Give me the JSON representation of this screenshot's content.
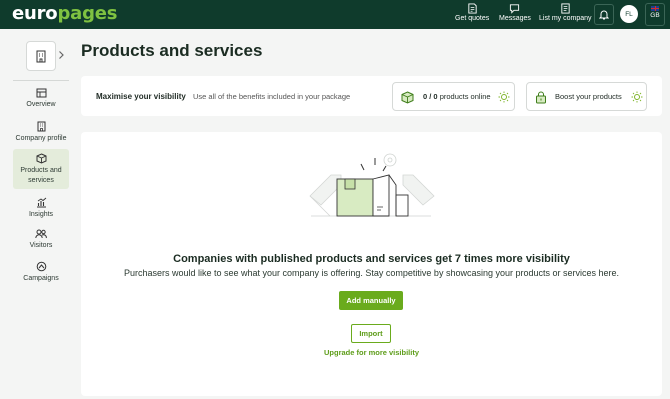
{
  "header": {
    "logo_part1": "euro",
    "logo_part2": "pages",
    "nav": [
      {
        "label": "Get quotes",
        "icon": "quotes-icon"
      },
      {
        "label": "Messages",
        "icon": "messages-icon"
      },
      {
        "label": "List my company",
        "icon": "list-company-icon"
      }
    ],
    "avatar_initials": "FL",
    "language": "GB"
  },
  "sidebar": {
    "items": [
      {
        "label": "Overview",
        "icon": "overview-icon",
        "active": false
      },
      {
        "label": "Company profile",
        "icon": "company-profile-icon",
        "active": false
      },
      {
        "label": "Products and services",
        "icon": "products-icon",
        "active": true
      },
      {
        "label": "Insights",
        "icon": "insights-icon",
        "active": false
      },
      {
        "label": "Visitors",
        "icon": "visitors-icon",
        "active": false
      },
      {
        "label": "Campaigns",
        "icon": "campaigns-icon",
        "active": false
      }
    ]
  },
  "page": {
    "title": "Products and services"
  },
  "visibility": {
    "title": "Maximise your visibility",
    "subtitle": "Use all of the benefits included in your package",
    "products_count": "0 / 0",
    "products_label": "products online",
    "boost_label": "Boost your products"
  },
  "empty_state": {
    "title": "Companies with published products and services get 7 times more visibility",
    "subtitle": "Purchasers would like to see what your company is offering. Stay competitive by showcasing your products or services here.",
    "add_button": "Add manually",
    "import_button": "Import",
    "upgrade_link": "Upgrade for more visibility"
  },
  "colors": {
    "header_bg": "#0f3b2c",
    "brand_green": "#7fc241",
    "button_green": "#6aab1d",
    "active_sidebar": "#e4ecdb"
  }
}
